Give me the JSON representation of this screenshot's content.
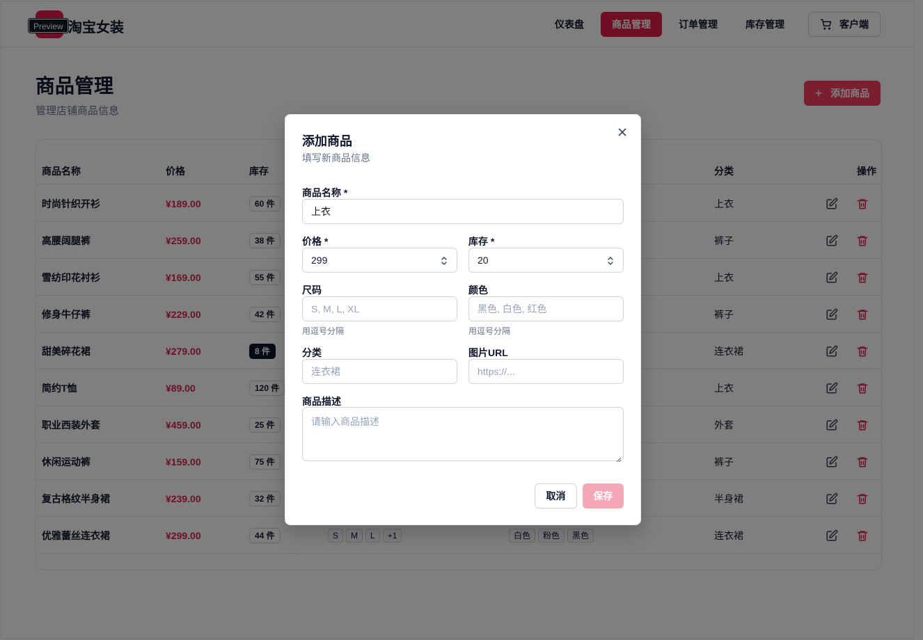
{
  "header": {
    "brand": "淘宝女装",
    "preview_badge": "Preview",
    "nav": [
      {
        "label": "仪表盘",
        "active": false
      },
      {
        "label": "商品管理",
        "active": true
      },
      {
        "label": "订单管理",
        "active": false
      },
      {
        "label": "库存管理",
        "active": false
      }
    ],
    "client_label": "客户端"
  },
  "page": {
    "title": "商品管理",
    "subtitle": "管理店铺商品信息",
    "add_label": "添加商品"
  },
  "table": {
    "headers": {
      "name": "商品名称",
      "price": "价格",
      "stock": "库存",
      "category": "分类",
      "actions": "操作"
    },
    "rows": [
      {
        "name": "时尚针织开衫",
        "price": "¥189.00",
        "stock": "60 件",
        "category": "上衣",
        "sizes": [],
        "colors": [],
        "low": false
      },
      {
        "name": "高腰阔腿裤",
        "price": "¥259.00",
        "stock": "38 件",
        "category": "裤子",
        "sizes": [],
        "colors": [],
        "low": false
      },
      {
        "name": "雪纺印花衬衫",
        "price": "¥169.00",
        "stock": "55 件",
        "category": "上衣",
        "sizes": [],
        "colors": [],
        "low": false
      },
      {
        "name": "修身牛仔裤",
        "price": "¥229.00",
        "stock": "42 件",
        "category": "裤子",
        "sizes": [],
        "colors": [],
        "low": false
      },
      {
        "name": "甜美碎花裙",
        "price": "¥279.00",
        "stock": "8 件",
        "category": "连衣裙",
        "sizes": [],
        "colors": [],
        "low": true
      },
      {
        "name": "简约T恤",
        "price": "¥89.00",
        "stock": "120 件",
        "category": "上衣",
        "sizes": [],
        "colors": [],
        "low": false
      },
      {
        "name": "职业西装外套",
        "price": "¥459.00",
        "stock": "25 件",
        "category": "外套",
        "sizes": [],
        "colors": [],
        "low": false
      },
      {
        "name": "休闲运动裤",
        "price": "¥159.00",
        "stock": "75 件",
        "category": "裤子",
        "sizes": [],
        "colors": [],
        "low": false
      },
      {
        "name": "复古格纹半身裙",
        "price": "¥239.00",
        "stock": "32 件",
        "category": "半身裙",
        "sizes": [],
        "colors": [],
        "low": false
      },
      {
        "name": "优雅蕾丝连衣裙",
        "price": "¥299.00",
        "stock": "44 件",
        "category": "连衣裙",
        "sizes": [
          "S",
          "M",
          "L",
          "+1"
        ],
        "colors": [
          "白色",
          "粉色",
          "黑色"
        ],
        "low": false
      }
    ]
  },
  "modal": {
    "title": "添加商品",
    "subtitle": "填写新商品信息",
    "name_label": "商品名称 *",
    "name_value": "上衣",
    "price_label": "价格 *",
    "price_value": "299",
    "stock_label": "库存 *",
    "stock_value": "20",
    "size_label": "尺码",
    "size_placeholder": "S, M, L, XL",
    "size_hint": "用逗号分隔",
    "color_label": "颜色",
    "color_placeholder": "黑色, 白色, 红色",
    "color_hint": "用逗号分隔",
    "category_label": "分类",
    "category_placeholder": "连衣裙",
    "image_label": "图片URL",
    "image_placeholder": "https://...",
    "desc_label": "商品描述",
    "desc_placeholder": "请输入商品描述",
    "cancel_label": "取消",
    "save_label": "保存"
  },
  "colors": {
    "accent": "#e11d48",
    "text": "#0f172a",
    "muted": "#64748b"
  }
}
